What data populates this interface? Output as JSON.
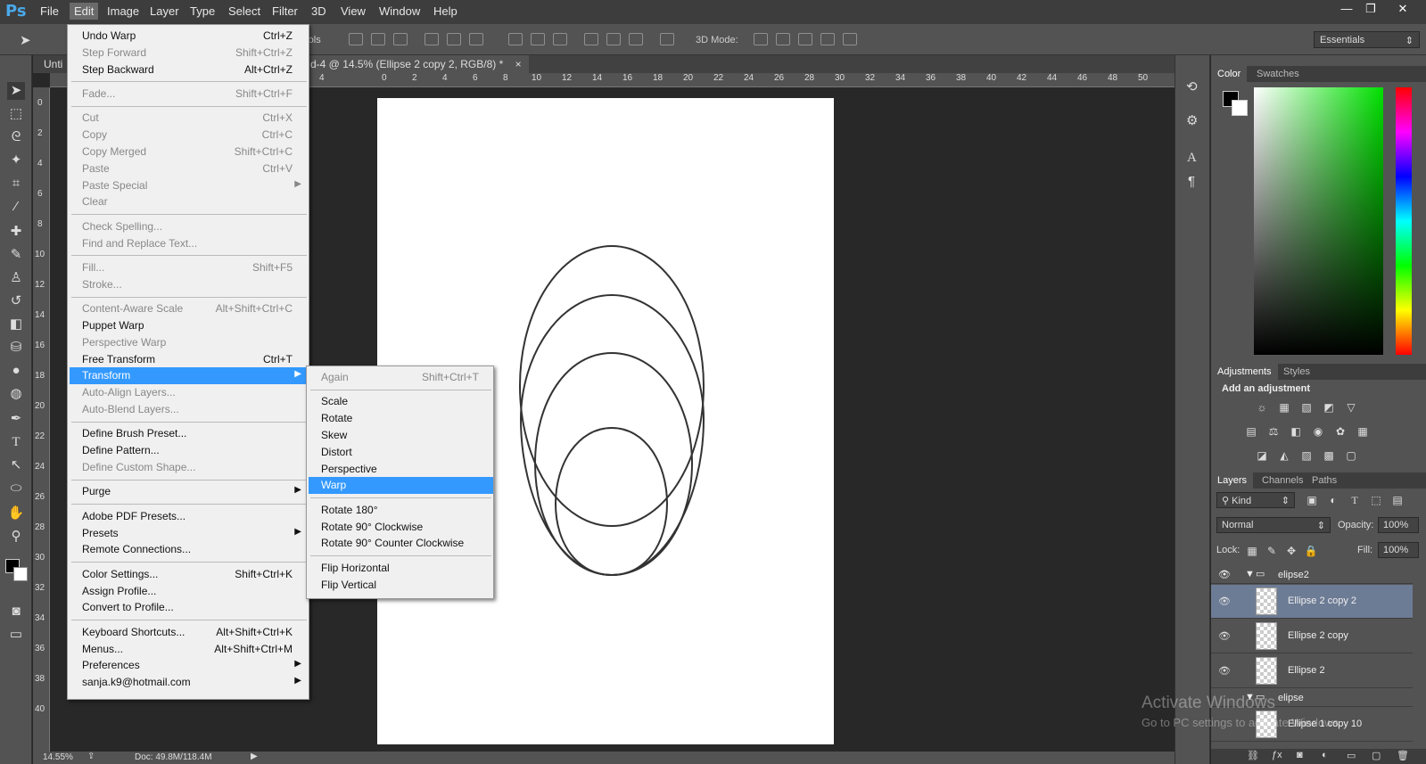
{
  "app": {
    "logo": "Ps"
  },
  "menubar": [
    "File",
    "Edit",
    "Image",
    "Layer",
    "Type",
    "Select",
    "Filter",
    "3D",
    "View",
    "Window",
    "Help"
  ],
  "window_controls": [
    "—",
    "❐",
    "✕"
  ],
  "options_bar": {
    "controls_label": "rols",
    "mode_label": "3D Mode:",
    "workspace": "Essentials"
  },
  "document": {
    "tab_left": "Unti",
    "tab_title": "d-4 @ 14.5% (Ellipse 2 copy 2, RGB/8) *",
    "tab_close": "×",
    "ruler_h": [
      "4",
      "0",
      "2",
      "4",
      "6",
      "8",
      "10",
      "12",
      "14",
      "16",
      "18",
      "20",
      "22",
      "24",
      "26",
      "28",
      "30",
      "32",
      "34",
      "36",
      "38",
      "40",
      "42",
      "44",
      "46",
      "48",
      "50"
    ],
    "ruler_v": [
      "0",
      "2",
      "4",
      "6",
      "8",
      "10",
      "12",
      "14",
      "16",
      "18",
      "20",
      "22",
      "24",
      "26",
      "28",
      "30",
      "32",
      "34",
      "36",
      "38",
      "40"
    ]
  },
  "status": {
    "zoom": "14.55%",
    "doc": "Doc: 49.8M/118.4M"
  },
  "edit_menu": [
    {
      "label": "Undo Warp",
      "shortcut": "Ctrl+Z",
      "disabled": false
    },
    {
      "label": "Step Forward",
      "shortcut": "Shift+Ctrl+Z",
      "disabled": true
    },
    {
      "label": "Step Backward",
      "shortcut": "Alt+Ctrl+Z",
      "disabled": false
    },
    {
      "sep": true
    },
    {
      "label": "Fade...",
      "shortcut": "Shift+Ctrl+F",
      "disabled": true
    },
    {
      "sep": true
    },
    {
      "label": "Cut",
      "shortcut": "Ctrl+X",
      "disabled": true
    },
    {
      "label": "Copy",
      "shortcut": "Ctrl+C",
      "disabled": true
    },
    {
      "label": "Copy Merged",
      "shortcut": "Shift+Ctrl+C",
      "disabled": true
    },
    {
      "label": "Paste",
      "shortcut": "Ctrl+V",
      "disabled": true
    },
    {
      "label": "Paste Special",
      "submenu": true,
      "disabled": true
    },
    {
      "label": "Clear",
      "disabled": true
    },
    {
      "sep": true
    },
    {
      "label": "Check Spelling...",
      "disabled": true
    },
    {
      "label": "Find and Replace Text...",
      "disabled": true
    },
    {
      "sep": true
    },
    {
      "label": "Fill...",
      "shortcut": "Shift+F5",
      "disabled": true
    },
    {
      "label": "Stroke...",
      "disabled": true
    },
    {
      "sep": true
    },
    {
      "label": "Content-Aware Scale",
      "shortcut": "Alt+Shift+Ctrl+C",
      "disabled": true
    },
    {
      "label": "Puppet Warp",
      "disabled": false
    },
    {
      "label": "Perspective Warp",
      "disabled": true
    },
    {
      "label": "Free Transform",
      "shortcut": "Ctrl+T",
      "disabled": false
    },
    {
      "label": "Transform",
      "submenu": true,
      "highlighted": true
    },
    {
      "label": "Auto-Align Layers...",
      "disabled": true
    },
    {
      "label": "Auto-Blend Layers...",
      "disabled": true
    },
    {
      "sep": true
    },
    {
      "label": "Define Brush Preset...",
      "disabled": false
    },
    {
      "label": "Define Pattern...",
      "disabled": false
    },
    {
      "label": "Define Custom Shape...",
      "disabled": true
    },
    {
      "sep": true
    },
    {
      "label": "Purge",
      "submenu": true
    },
    {
      "sep": true
    },
    {
      "label": "Adobe PDF Presets..."
    },
    {
      "label": "Presets",
      "submenu": true
    },
    {
      "label": "Remote Connections..."
    },
    {
      "sep": true
    },
    {
      "label": "Color Settings...",
      "shortcut": "Shift+Ctrl+K"
    },
    {
      "label": "Assign Profile..."
    },
    {
      "label": "Convert to Profile..."
    },
    {
      "sep": true
    },
    {
      "label": "Keyboard Shortcuts...",
      "shortcut": "Alt+Shift+Ctrl+K"
    },
    {
      "label": "Menus...",
      "shortcut": "Alt+Shift+Ctrl+M"
    },
    {
      "label": "Preferences",
      "submenu": true
    },
    {
      "label": "sanja.k9@hotmail.com",
      "submenu": true
    }
  ],
  "transform_submenu": [
    {
      "label": "Again",
      "shortcut": "Shift+Ctrl+T",
      "disabled": true
    },
    {
      "sep": true
    },
    {
      "label": "Scale"
    },
    {
      "label": "Rotate"
    },
    {
      "label": "Skew"
    },
    {
      "label": "Distort"
    },
    {
      "label": "Perspective"
    },
    {
      "label": "Warp",
      "highlighted": true
    },
    {
      "sep": true
    },
    {
      "label": "Rotate 180°"
    },
    {
      "label": "Rotate 90° Clockwise"
    },
    {
      "label": "Rotate 90° Counter Clockwise"
    },
    {
      "sep": true
    },
    {
      "label": "Flip Horizontal"
    },
    {
      "label": "Flip Vertical"
    }
  ],
  "panels": {
    "color_tabs": [
      "Color",
      "Swatches"
    ],
    "adjust_tabs": [
      "Adjustments",
      "Styles"
    ],
    "add_adjustment": "Add an adjustment",
    "layer_tabs": [
      "Layers",
      "Channels",
      "Paths"
    ],
    "kind": "Kind",
    "blend_mode": "Normal",
    "opacity_label": "Opacity:",
    "opacity": "100%",
    "lock_label": "Lock:",
    "fill_label": "Fill:",
    "fill": "100%",
    "groups": [
      "elipse2",
      "elipse"
    ],
    "layers": [
      "Ellipse 2 copy 2",
      "Ellipse 2 copy",
      "Ellipse 2",
      "Ellipse 1 copy 10"
    ]
  },
  "watermark": {
    "title": "Activate Windows",
    "subtitle": "Go to PC settings to activate Windows."
  }
}
